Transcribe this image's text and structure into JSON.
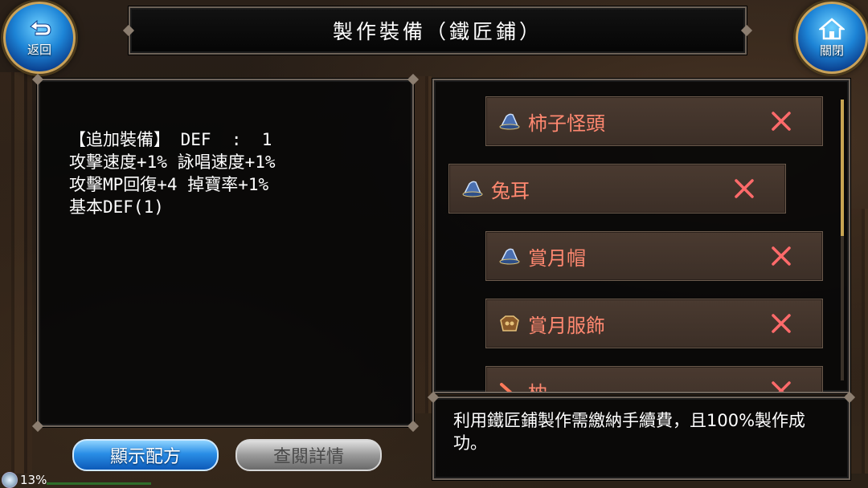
{
  "header": {
    "title": "製作裝備（鐵匠鋪）",
    "back_label": "返回",
    "close_label": "關閉"
  },
  "detail": {
    "lines": [
      "【追加裝備】 DEF  :  1",
      "攻擊速度+1% 詠唱速度+1%",
      "攻擊MP回復+4 掉寶率+1%",
      "基本DEF(1)"
    ]
  },
  "buttons": {
    "recipe_label": "顯示配方",
    "details_label": "查閱詳情"
  },
  "status": {
    "percent": "13%"
  },
  "list": {
    "items": [
      {
        "name": "柿子怪頭",
        "icon": "hat-icon"
      },
      {
        "name": "兔耳",
        "icon": "hat-icon"
      },
      {
        "name": "賞月帽",
        "icon": "hat-icon"
      },
      {
        "name": "賞月服飾",
        "icon": "armor-icon"
      },
      {
        "name": "枕",
        "icon": "weapon-icon"
      }
    ]
  },
  "info": {
    "text": "利用鐵匠鋪製作需繳納手續費，且100%製作成功。"
  },
  "colors": {
    "item_name": "#ff8870",
    "remove_x": "#ff6a6a",
    "accent_blue": "#1d84d6"
  }
}
